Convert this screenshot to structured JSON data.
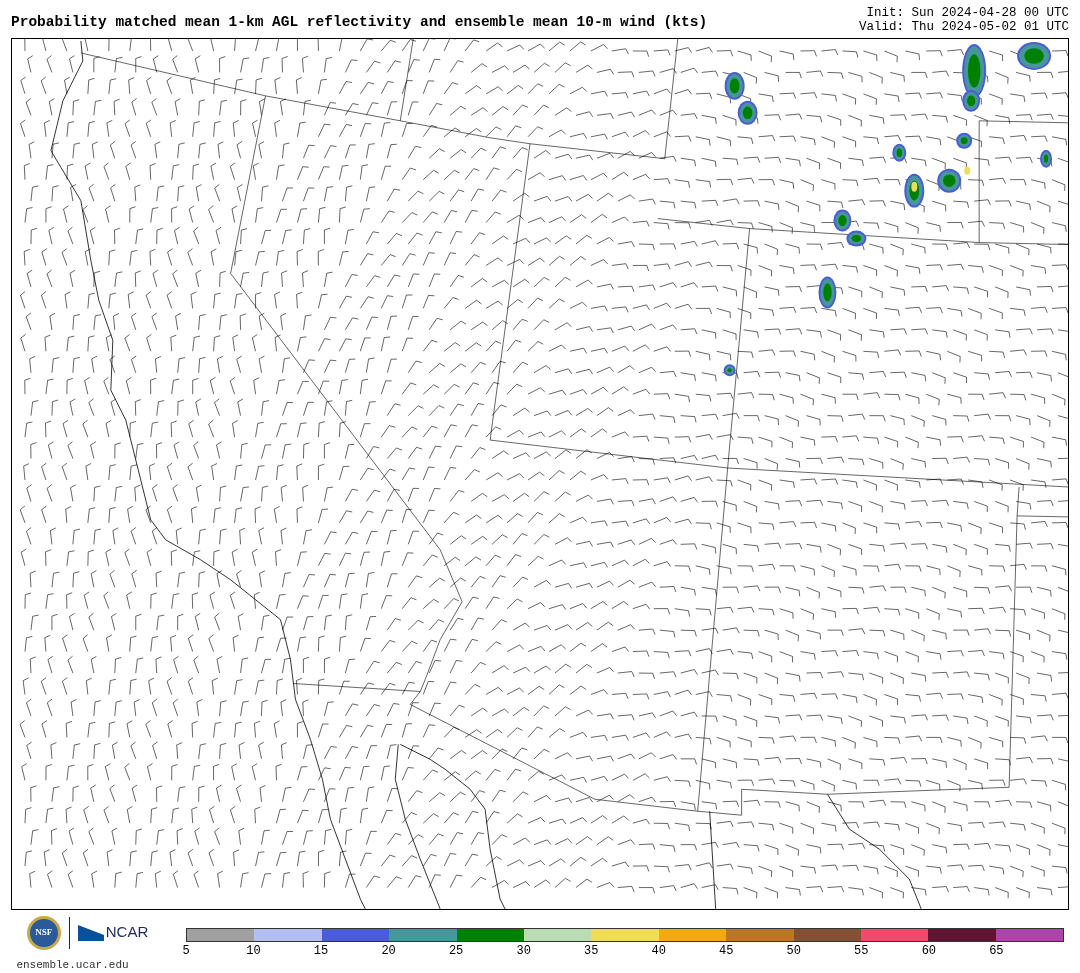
{
  "title": "Probability matched mean 1-km AGL reflectivity and ensemble mean 10-m wind (kts)",
  "init": "Init: Sun 2024-04-28 00 UTC",
  "valid": "Valid: Thu 2024-05-02 01 UTC",
  "logos": {
    "nsf": "NSF",
    "ncar": "NCAR"
  },
  "colorbar": {
    "segments": [
      {
        "color": "#a0a0a0"
      },
      {
        "color": "#b4bef0"
      },
      {
        "color": "#4b5cd7"
      },
      {
        "color": "#46969b"
      },
      {
        "color": "#008000"
      },
      {
        "color": "#b9dcb5"
      },
      {
        "color": "#f0dc5a"
      },
      {
        "color": "#f0aa14"
      },
      {
        "color": "#b97828"
      },
      {
        "color": "#825032"
      },
      {
        "color": "#f04b6e"
      },
      {
        "color": "#5f1432"
      },
      {
        "color": "#aa46aa"
      }
    ],
    "ticks": [
      "5",
      "10",
      "15",
      "20",
      "25",
      "30",
      "35",
      "40",
      "45",
      "50",
      "55",
      "60",
      "65"
    ]
  },
  "footer": "ensemble.ucar.edu"
}
